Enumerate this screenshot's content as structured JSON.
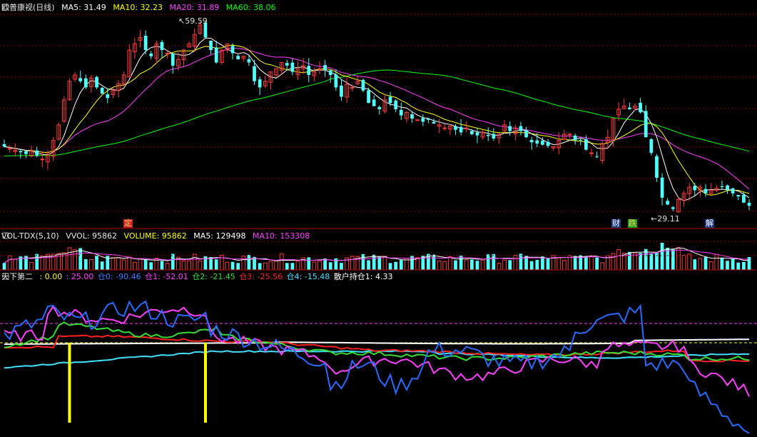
{
  "header_main": {
    "title": "欧普康视(日线)",
    "ma5": "MA5: 31.49",
    "ma10": "MA10: 32.23",
    "ma20": "MA20: 31.89",
    "ma60": "MA60: 38.06"
  },
  "header_vol": {
    "title": "VOL-TDX(5,10)",
    "vvol": "VVOL: 95862",
    "volume": "VOLUME: 95862",
    "ma5": "MA5: 129498",
    "ma10": "MA10: 153308"
  },
  "header_ind": {
    "title": "天下第二",
    "v0": ": 0.00",
    "v25": ": 25.00",
    "c0": "仓0: -90.46",
    "c1": "仓1: -52.01",
    "c2": "仓2: -21.45",
    "c3": "仓3: -25.56",
    "c4": "仓4: -15.48",
    "retail": "散户持仓1: 4.33"
  },
  "annotations": {
    "high": "59.59",
    "low": "29.11",
    "marker_ding": "定",
    "marker_cai": "财",
    "marker_die": "跌",
    "marker_jie": "解"
  },
  "colors": {
    "up": "#ff3b3b",
    "down": "#54ffff",
    "ma5": "#ffffff",
    "ma10": "#ffff00",
    "ma20": "#ff40ff",
    "ma60": "#00ff00",
    "grid": "#8b0000",
    "ind_blue": "#2a6bff",
    "ind_magenta": "#ff40ff",
    "ind_green": "#33dd33",
    "ind_red": "#ff2020",
    "ind_cyan": "#40e0ff",
    "ind_white": "#ffffff"
  },
  "chart_data": {
    "type": "candlestick",
    "symbol": "欧普康视",
    "period": "日线",
    "price_high": 59.59,
    "price_low": 29.11,
    "ma_last": {
      "MA5": 31.49,
      "MA10": 32.23,
      "MA20": 31.89,
      "MA60": 38.06
    },
    "volume_last": {
      "VVOL": 95862,
      "MA5": 129498,
      "MA10": 153308
    },
    "close_series": [
      39.5,
      39.2,
      38.9,
      38.6,
      38.3,
      38.8,
      38.0,
      37.5,
      38.3,
      40.5,
      43.0,
      47.0,
      50.0,
      51.0,
      50.0,
      49.0,
      50.5,
      49.0,
      48.0,
      47.3,
      48.5,
      49.6,
      51.0,
      55.0,
      56.0,
      57.0,
      55.0,
      54.0,
      56.0,
      55.0,
      54.5,
      52.5,
      53.5,
      55.0,
      56.0,
      57.5,
      59.0,
      57.0,
      55.0,
      53.0,
      55.0,
      56.0,
      54.5,
      53.5,
      54.0,
      53.0,
      50.0,
      49.0,
      50.0,
      51.5,
      52.0,
      53.0,
      52.5,
      51.5,
      52.0,
      52.5,
      51.0,
      51.5,
      52.0,
      51.8,
      51.0,
      49.0,
      47.5,
      49.5,
      49.0,
      50.0,
      48.5,
      46.5,
      46.0,
      45.5,
      47.0,
      46.5,
      45.5,
      44.5,
      45.0,
      44.0,
      43.8,
      43.5,
      43.8,
      43.2,
      43.0,
      42.5,
      42.8,
      42.2,
      41.8,
      42.5,
      41.5,
      41.3,
      41.8,
      41.2,
      40.8,
      41.5,
      43.0,
      42.0,
      42.5,
      42.0,
      41.0,
      40.2,
      40.0,
      39.8,
      39.6,
      39.5,
      40.5,
      41.5,
      41.5,
      40.5,
      40.5,
      39.0,
      38.5,
      37.8,
      40.0,
      41.0,
      44.0,
      45.5,
      46.0,
      45.5,
      46.0,
      45.0,
      41.0,
      38.5,
      34.5,
      31.3,
      30.2,
      29.5,
      31.0,
      32.0,
      33.0,
      32.5,
      33.0,
      32.0,
      32.5,
      32.8,
      33.0,
      32.5,
      32.0,
      31.5,
      30.5,
      30.0
    ],
    "indicator_levels": {
      "0": 0.0,
      "25": 25.0
    },
    "indicator_last": {
      "仓0": -90.46,
      "仓1": -52.01,
      "仓2": -21.45,
      "仓3": -25.56,
      "仓4": -15.48,
      "散户持仓1": 4.33
    }
  }
}
